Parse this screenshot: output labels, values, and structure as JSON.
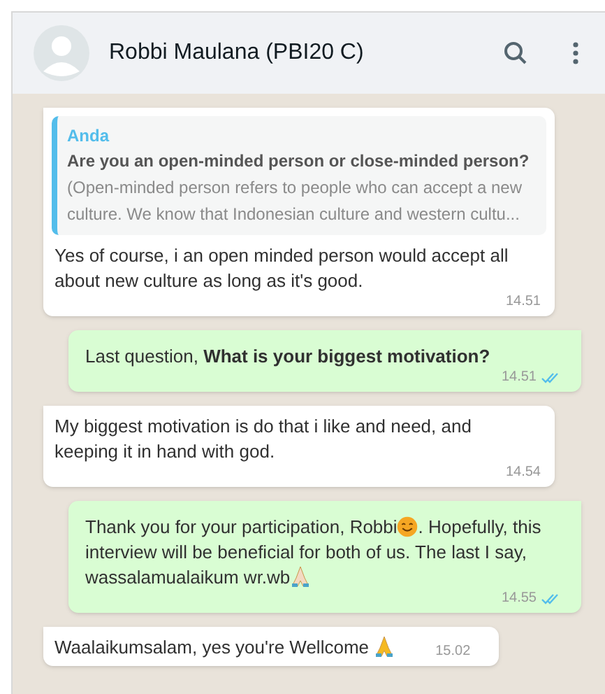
{
  "header": {
    "contact_name": "Robbi Maulana (PBI20 C)"
  },
  "messages": [
    {
      "outgoing": false,
      "quote": {
        "author": "Anda",
        "title": "Are you an open-minded person or close-minded person?",
        "text": "(Open-minded person refers to people who can accept a new culture. We know that Indonesian culture and western cultu..."
      },
      "parts": [
        {
          "kind": "text",
          "text": "Yes of course, i an open minded person would accept all about new culture as long as it's good."
        }
      ],
      "time": "14.51"
    },
    {
      "outgoing": true,
      "parts": [
        {
          "kind": "text",
          "text": "Last question, **What is your biggest motivation?**"
        }
      ],
      "time": "14.51",
      "read": true
    },
    {
      "outgoing": false,
      "parts": [
        {
          "kind": "text",
          "text": "My biggest motivation is do that i like and need, and keeping it in hand with god."
        }
      ],
      "time": "14.54"
    },
    {
      "outgoing": true,
      "parts": [
        {
          "kind": "text",
          "text": "Thank you for your participation, Robbi"
        },
        {
          "kind": "smile"
        },
        {
          "kind": "text",
          "text": ". Hopefully, this interview will be beneficial for both of us. The last I say, wassalamualaikum wr.wb"
        },
        {
          "kind": "pray-light"
        }
      ],
      "time": "14.55",
      "read": true
    },
    {
      "outgoing": false,
      "parts": [
        {
          "kind": "text",
          "text": "Waalaikumsalam, yes you're Wellcome "
        },
        {
          "kind": "pray"
        }
      ],
      "time": "15.02"
    }
  ]
}
